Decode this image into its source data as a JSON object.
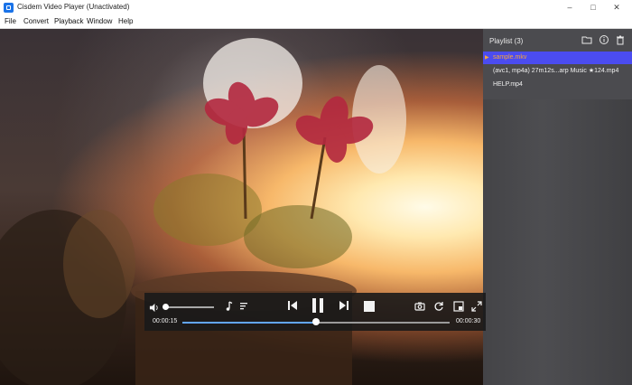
{
  "window": {
    "title": "Cisdem Video Player (Unactivated)"
  },
  "menu": {
    "items": [
      "File",
      "Convert",
      "Playback",
      "Window",
      "Help"
    ]
  },
  "playlist": {
    "title": "Playlist (3)",
    "items": [
      {
        "name": "sample.mkv",
        "active": true
      },
      {
        "name": "(avc1, mp4a) 27m12s...arp Music ★124.mp4",
        "active": false
      },
      {
        "name": "HELP.mp4",
        "active": false
      }
    ]
  },
  "player": {
    "current_time": "00:00:15",
    "total_time": "00:00:30",
    "progress": 0.5,
    "volume": 0.02
  },
  "colors": {
    "accent": "#4b4cf0",
    "active_text": "#f7a63a",
    "seek_fill": "#62a6ff"
  },
  "icons": [
    "app-icon",
    "minimize-icon",
    "maximize-icon",
    "close-icon",
    "folder-icon",
    "info-icon",
    "trash-icon",
    "volume-icon",
    "music-note-icon",
    "subtitle-icon",
    "previous-icon",
    "pause-icon",
    "next-icon",
    "stop-icon",
    "screenshot-icon",
    "rotate-icon",
    "crop-icon",
    "fullscreen-icon"
  ]
}
